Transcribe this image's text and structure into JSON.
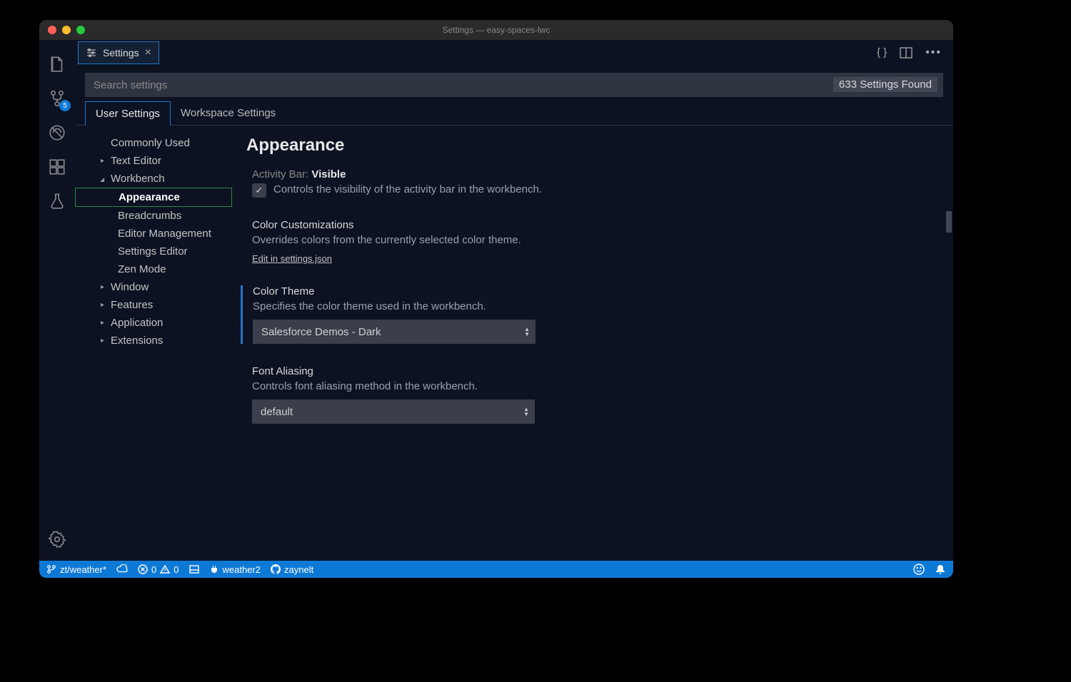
{
  "window": {
    "title": "Settings — easy-spaces-lwc"
  },
  "activityBar": {
    "sourceControlBadge": "5"
  },
  "tab": {
    "label": "Settings"
  },
  "search": {
    "placeholder": "Search settings",
    "count": "633 Settings Found"
  },
  "scopes": {
    "user": "User Settings",
    "workspace": "Workspace Settings"
  },
  "toc": {
    "commonlyUsed": "Commonly Used",
    "textEditor": "Text Editor",
    "workbench": "Workbench",
    "appearance": "Appearance",
    "breadcrumbs": "Breadcrumbs",
    "editorManagement": "Editor Management",
    "settingsEditor": "Settings Editor",
    "zenMode": "Zen Mode",
    "window": "Window",
    "features": "Features",
    "application": "Application",
    "extensions": "Extensions"
  },
  "content": {
    "heading": "Appearance",
    "activityBar": {
      "titlePrefix": "Activity Bar: ",
      "titleBold": "Visible",
      "desc": "Controls the visibility of the activity bar in the workbench.",
      "checked": true
    },
    "colorCustomizations": {
      "title": "Color Customizations",
      "desc": "Overrides colors from the currently selected color theme.",
      "link": "Edit in settings.json"
    },
    "colorTheme": {
      "title": "Color Theme",
      "desc": "Specifies the color theme used in the workbench.",
      "value": "Salesforce Demos - Dark"
    },
    "fontAliasing": {
      "title": "Font Aliasing",
      "desc": "Controls font aliasing method in the workbench.",
      "value": "default"
    }
  },
  "status": {
    "branch": "zt/weather*",
    "errors": "0",
    "warnings": "0",
    "org": "weather2",
    "github": "zaynelt"
  }
}
